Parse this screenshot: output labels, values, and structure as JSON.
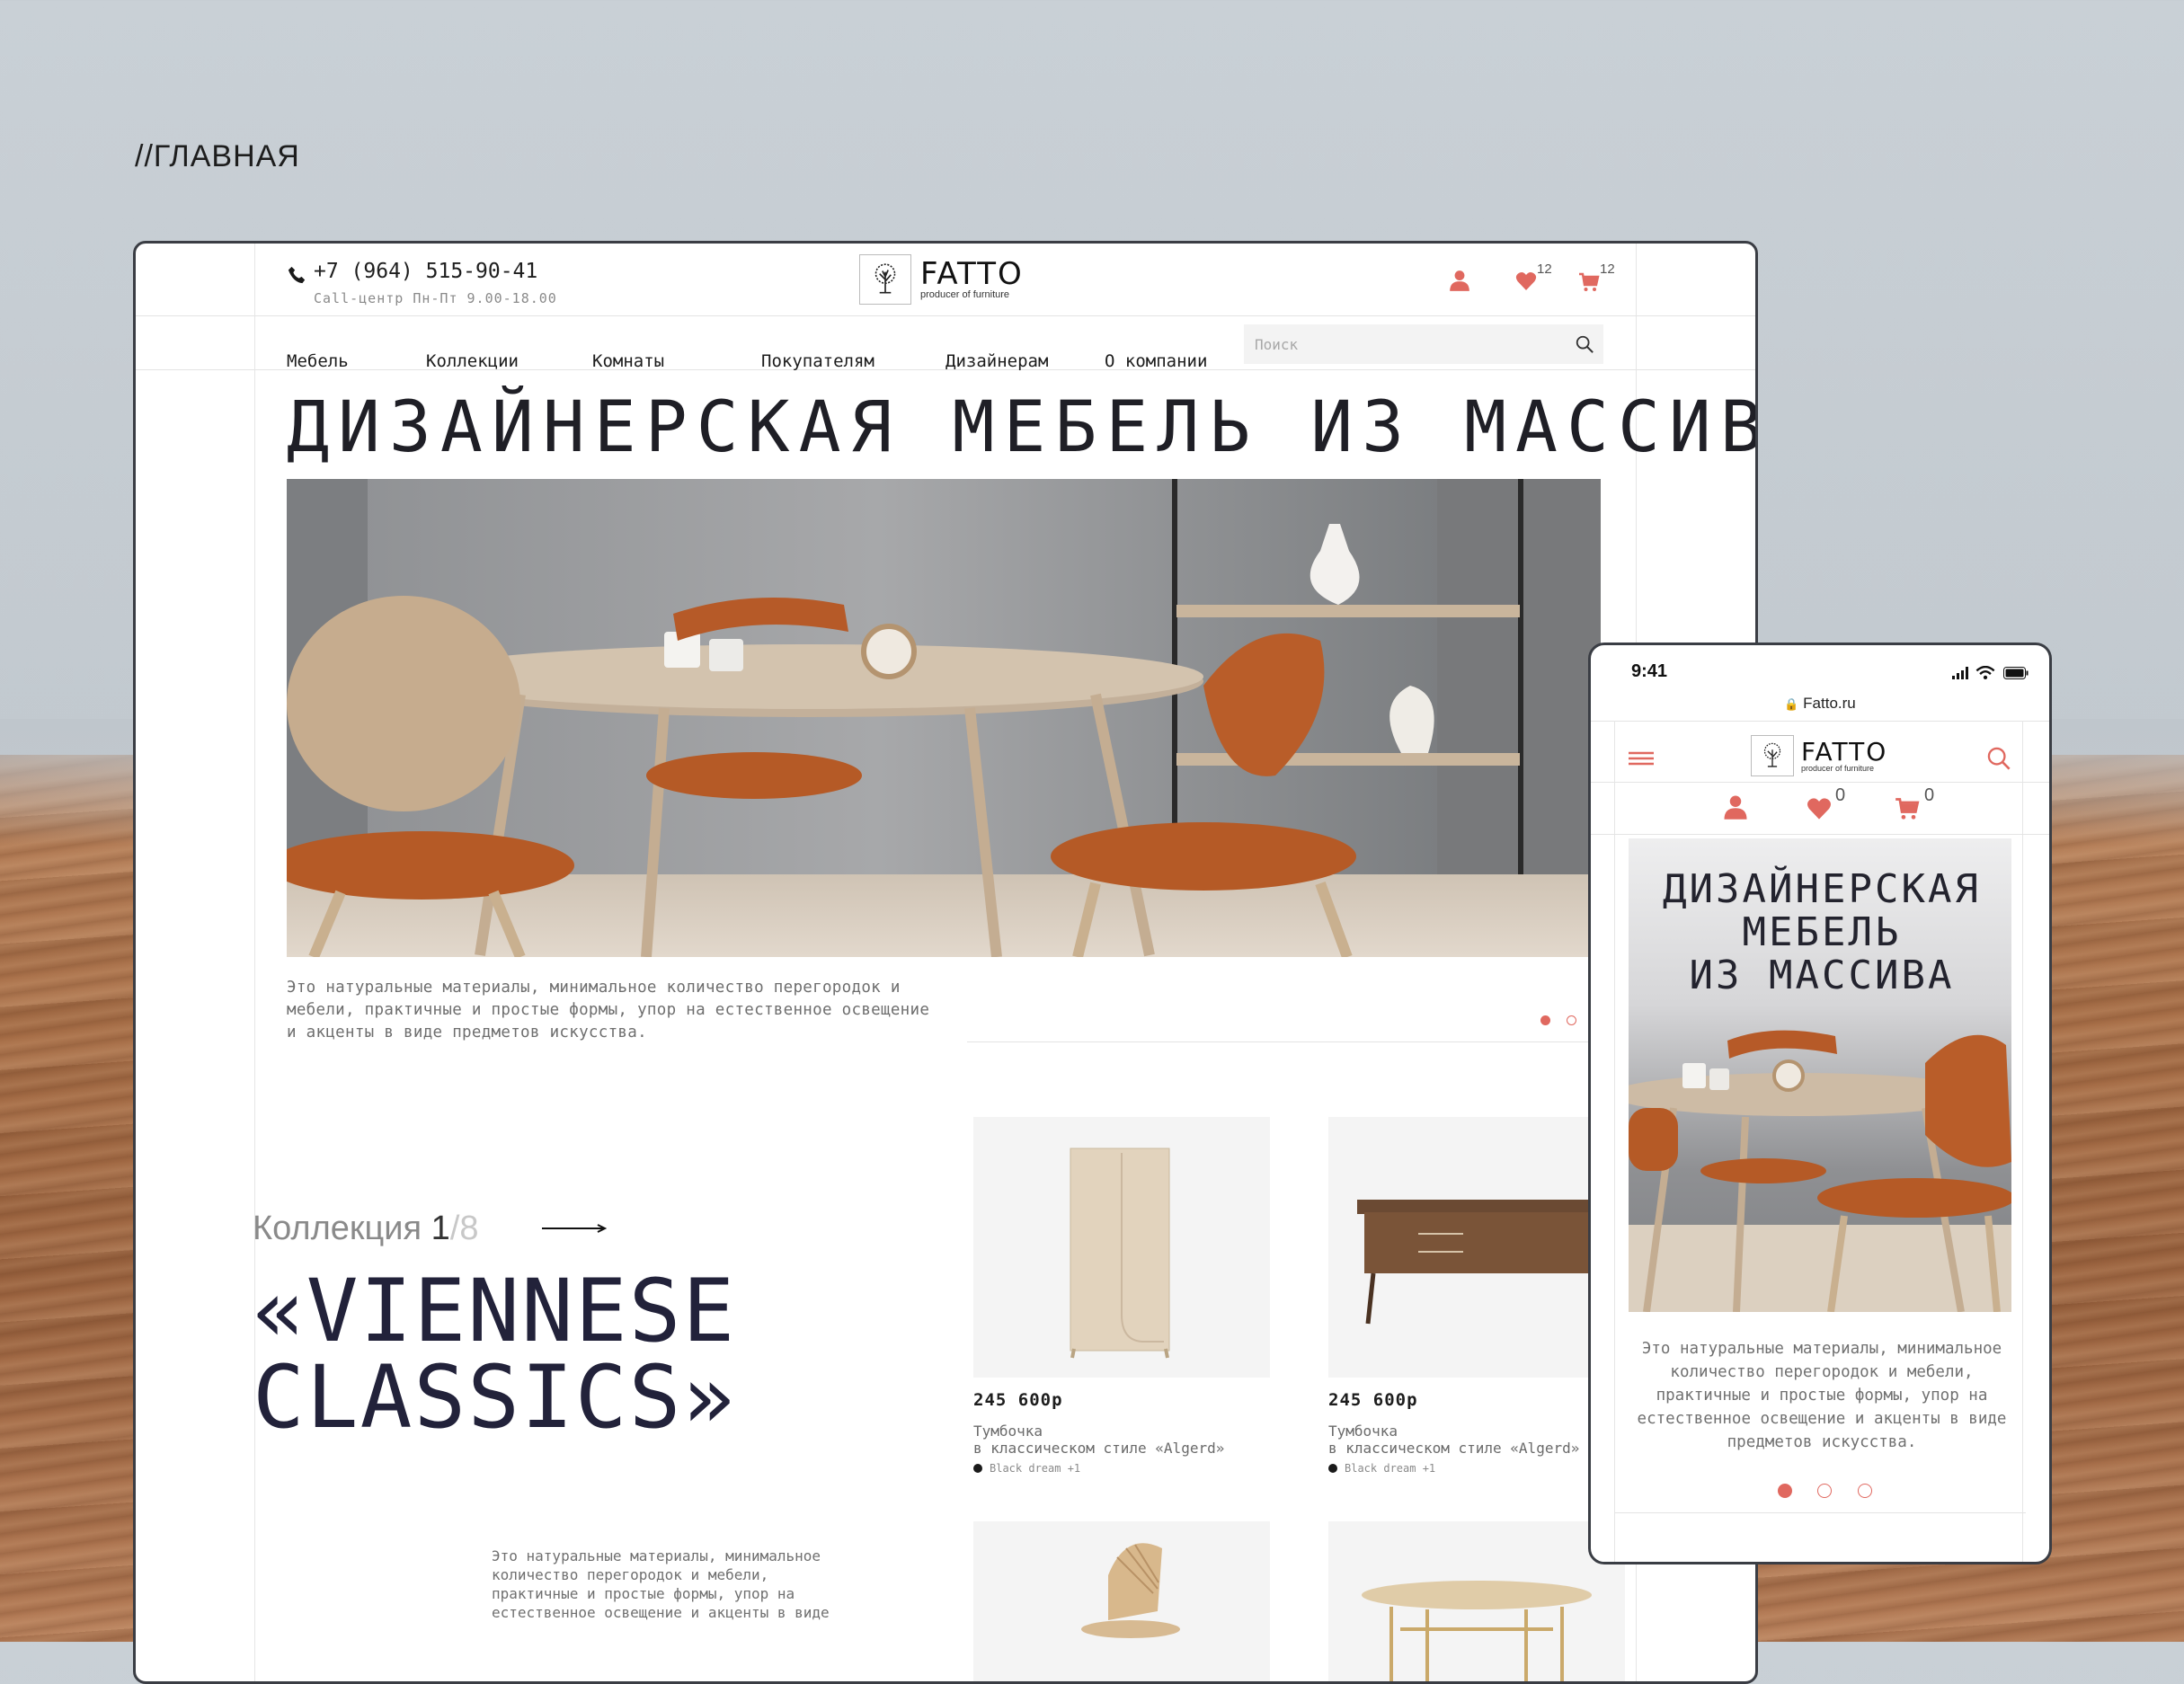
{
  "section_label": "//ГЛАВНАЯ",
  "colors": {
    "accent": "#e0685f",
    "text_dark": "#1f1f26",
    "muted": "#6e6e6e"
  },
  "header": {
    "phone": "+7 (964) 515-90-41",
    "call_center": "Call-центр Пн-Пт 9.00-18.00",
    "logo_name": "FATTO",
    "logo_tagline": "producer of furniture",
    "favorites_count": "12",
    "cart_count": "12"
  },
  "nav": {
    "items": [
      "Мебель",
      "Коллекции",
      "Комнаты",
      "Покупателям",
      "Дизайнерам",
      "О компании"
    ],
    "search_placeholder": "Поиск"
  },
  "hero": {
    "title": "ДИЗАЙНЕРСКАЯ МЕБЕЛЬ ИЗ МАССИВА",
    "description": "Это натуральные материалы, минимальное количество перегородок и мебели, практичные и простые формы, упор на естественное освещение и акценты в виде предметов искусства.",
    "slides_total": 2,
    "active_slide": 1
  },
  "collection": {
    "label": "Коллекция",
    "current": "1",
    "total": "/8",
    "title_line1": "«VIENNESE",
    "title_line2": "CLASSICS»",
    "description": "Это натуральные материалы, минимальное количество перегородок и мебели, практичные и простые формы, упор на естественное освещение и акценты в виде"
  },
  "products": [
    {
      "price": "245 600р",
      "name_line1": "Тумбочка",
      "name_line2": "в классическом стиле «Algerd»",
      "color": "Black dream +1"
    },
    {
      "price": "245 600р",
      "name_line1": "Тумбочка",
      "name_line2": "в классическом стиле «Algerd»",
      "color": "Black dream +1"
    }
  ],
  "mobile": {
    "time": "9:41",
    "url": "Fatto.ru",
    "favorites_count": "0",
    "cart_count": "0",
    "title_line1": "ДИЗАЙНЕРСКАЯ",
    "title_line2": "МЕБЕЛЬ",
    "title_line3": "ИЗ МАССИВА",
    "description": "Это натуральные материалы, минимальное количество перегородок и мебели, практичные и простые формы, упор на естественное освещение и акценты в виде предметов искусства.",
    "slides_total": 3,
    "active_slide": 1
  }
}
